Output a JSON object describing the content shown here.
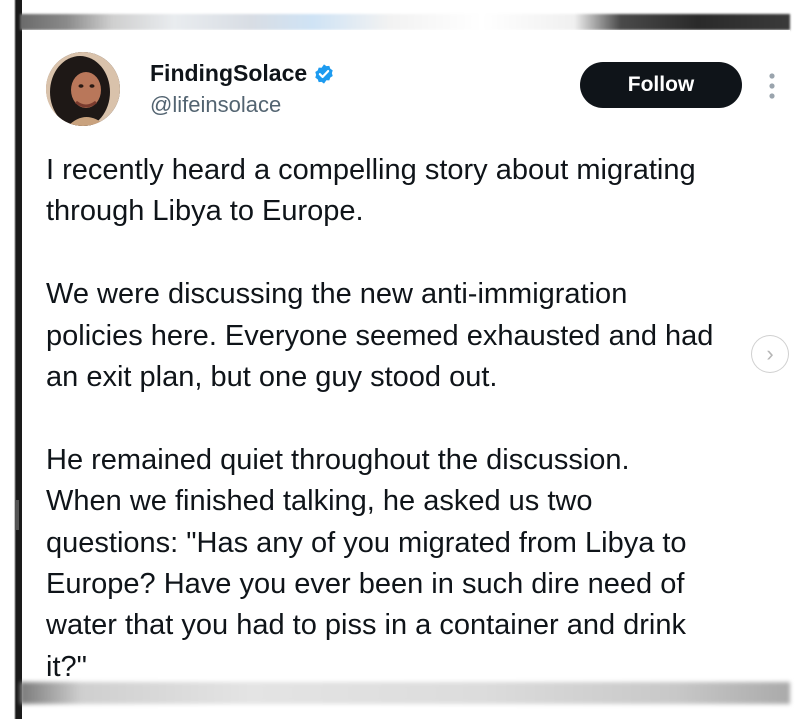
{
  "author": {
    "display_name": "FindingSolace",
    "handle": "@lifeinsolace",
    "verified": true,
    "avatar_icon": "profile-photo"
  },
  "actions": {
    "follow_label": "Follow",
    "more_icon": "vertical-ellipsis-icon"
  },
  "overlay": {
    "next_icon": "chevron-right-icon",
    "next_symbol": "›"
  },
  "tweet": {
    "paragraphs": [
      "I recently heard a compelling story about migrating\nthrough Libya to Europe.",
      "We were discussing the new anti-immigration\npolicies here. Everyone seemed exhausted and had\nan exit plan, but one guy stood out.",
      "He remained quiet throughout the discussion.\nWhen we finished talking, he asked us two\nquestions: \"Has any of you migrated from Libya to\nEurope? Have you ever been in such dire need of\nwater that you had to piss in a container and drink\nit?\""
    ]
  },
  "colors": {
    "text_primary": "#0f1419",
    "text_secondary": "#536471",
    "button_bg": "#0f1419",
    "verified_blue": "#1d9bf0"
  }
}
